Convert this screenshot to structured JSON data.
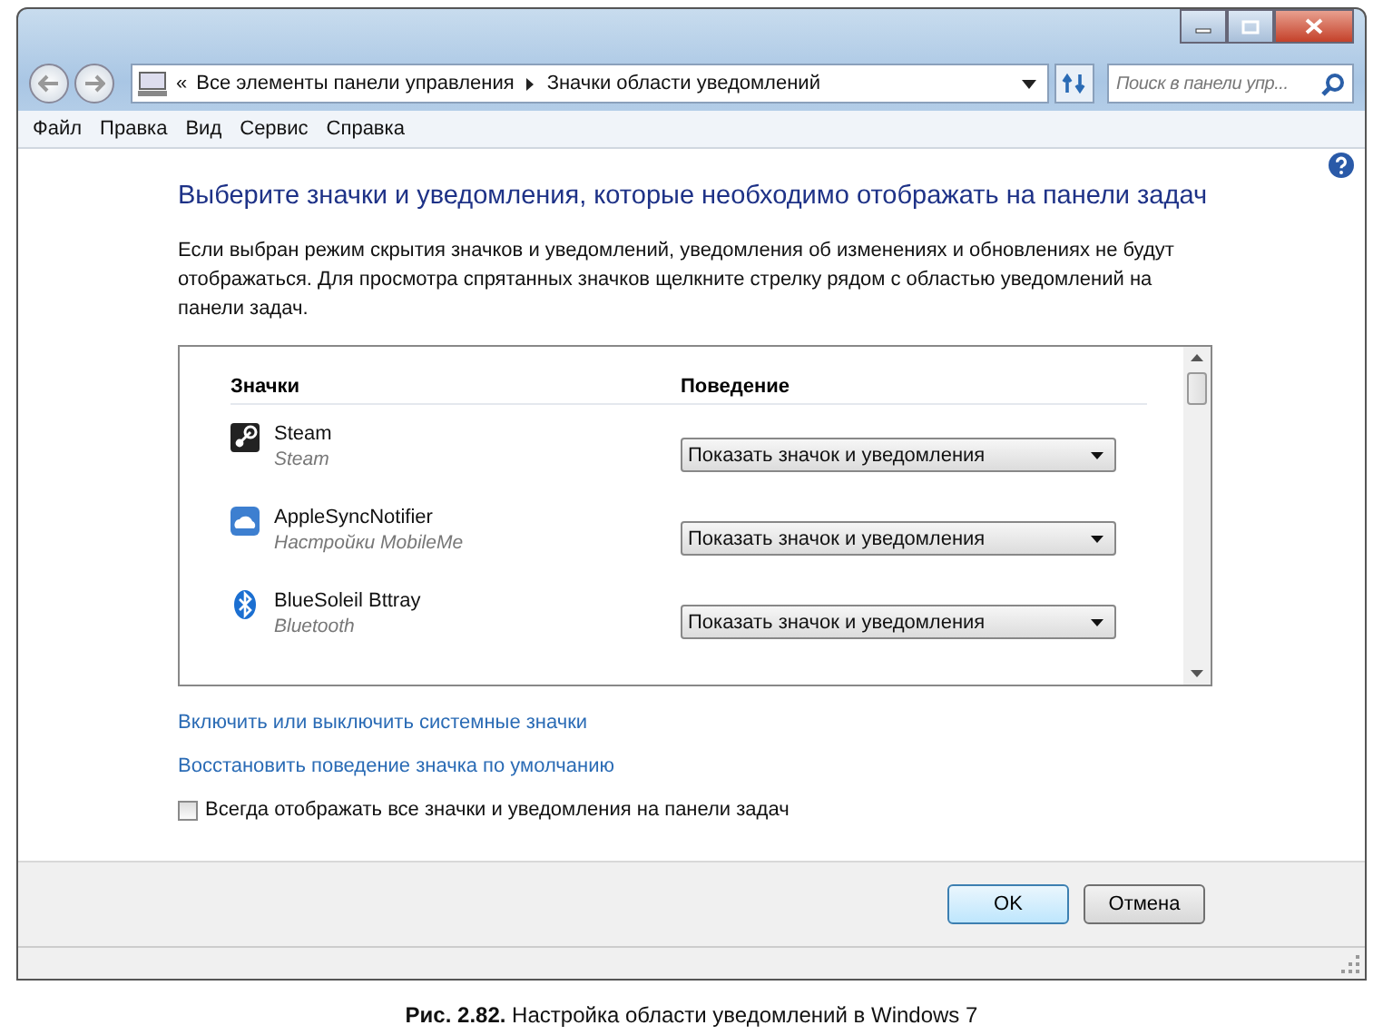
{
  "address_bar": {
    "overflow": "«",
    "crumbs": [
      "Все элементы панели управления",
      "Значки области уведомлений"
    ]
  },
  "search": {
    "placeholder": "Поиск в панели упр..."
  },
  "menu": [
    "Файл",
    "Правка",
    "Вид",
    "Сервис",
    "Справка"
  ],
  "heading": "Выберите значки и уведомления, которые необходимо отображать на панели задач",
  "description": "Если выбран режим скрытия значков и уведомлений, уведомления об изменениях и обновлениях не будут отображаться. Для просмотра спрятанных значков щелкните стрелку рядом с областью уведомлений на панели задач.",
  "table": {
    "columns": [
      "Значки",
      "Поведение"
    ],
    "rows": [
      {
        "kind": "steam",
        "name": "Steam",
        "subtitle": "Steam",
        "behavior": "Показать значок и уведомления"
      },
      {
        "kind": "cloud",
        "name": "AppleSyncNotifier",
        "subtitle": "Настройки MobileMe",
        "behavior": "Показать значок и уведомления"
      },
      {
        "kind": "bluetooth",
        "name": "BlueSoleil Bttray",
        "subtitle": "Bluetooth",
        "behavior": "Показать значок и уведомления"
      }
    ]
  },
  "links": [
    "Включить или выключить системные значки",
    "Восстановить поведение значка по умолчанию"
  ],
  "always_show": {
    "label": "Всегда отображать все значки и уведомления на панели задач",
    "checked": false
  },
  "buttons": [
    {
      "label": "OK",
      "default": true
    },
    {
      "label": "Отмена",
      "default": false
    }
  ],
  "caption": "**Рис. 2.82.** Настройка области уведомлений в Windows 7"
}
